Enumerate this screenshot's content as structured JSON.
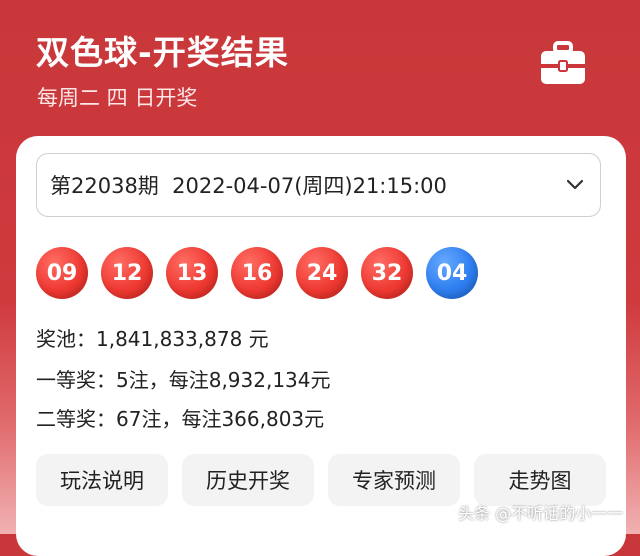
{
  "header": {
    "title": "双色球-开奖结果",
    "subtitle": "每周二 四 日开奖",
    "icon": "briefcase-icon"
  },
  "draw_select": {
    "value": "第22038期  2022-04-07(周四)21:15:00",
    "icon": "chevron-down-icon"
  },
  "balls": {
    "red": [
      "09",
      "12",
      "13",
      "16",
      "24",
      "32"
    ],
    "blue": [
      "04"
    ],
    "colors": {
      "red": "#e83a32",
      "blue": "#2f7ff0"
    }
  },
  "info": {
    "pool": "奖池：1,841,833,878 元",
    "first_prize": "一等奖：5注，每注8,932,134元",
    "second_prize": "二等奖：67注，每注366,803元"
  },
  "buttons": [
    "玩法说明",
    "历史开奖",
    "专家预测",
    "走势图"
  ],
  "watermark": "头条 @不听话的小一一",
  "theme": {
    "primary": "#cc3539"
  }
}
